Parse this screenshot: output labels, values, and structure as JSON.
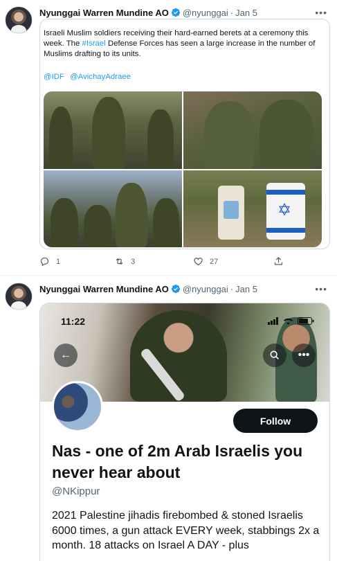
{
  "colors": {
    "accent": "#1d9bf0",
    "text": "#0f1419",
    "muted": "#536471",
    "border": "#cfd9de"
  },
  "tweets": [
    {
      "author_name": "Nyunggai Warren Mundine AO",
      "handle": "@nyunggai",
      "separator": "·",
      "date": "Jan 5",
      "text_part1": "Israeli Muslim soldiers receiving their hard-earned berets at a ceremony this week. The ",
      "hashtag": "#Israel",
      "text_part2": " Defense Forces has seen a large increase in the number of Muslims drafting to its units.",
      "mentions": [
        "@IDF",
        "@AvichayAdraee"
      ],
      "reply_count": "1",
      "retweet_count": "3",
      "like_count": "27",
      "icons": [
        "verified-icon",
        "more-icon",
        "reply-icon",
        "retweet-icon",
        "like-icon",
        "share-icon"
      ]
    },
    {
      "author_name": "Nyunggai Warren Mundine AO",
      "handle": "@nyunggai",
      "separator": "·",
      "date": "Jan 5",
      "screenshot": {
        "time": "11:22",
        "follow_label": "Follow",
        "profile_name": "Nas - one of 2m Arab Israelis you never hear about",
        "profile_handle": "@NKippur",
        "bio": "2021 Palestine jihadis firebombed & stoned Israelis 6000 times, a gun attack EVERY week, stabbings 2x a month. 18 attacks on Israel A DAY - plus"
      }
    }
  ]
}
